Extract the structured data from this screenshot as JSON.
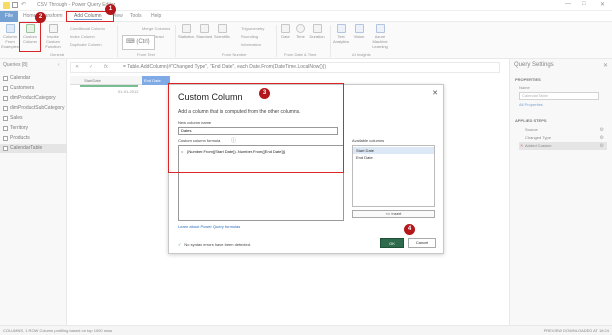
{
  "window": {
    "title": "CSV Through - Power Query Editor",
    "controls": [
      "—",
      "□",
      "✕"
    ]
  },
  "menu": {
    "file": "File",
    "tabs": [
      "Home",
      "Transform",
      "Add Column",
      "View",
      "Tools",
      "Help"
    ]
  },
  "ribbon": {
    "big_buttons": [
      "Column From Examples",
      "Custom Column",
      "Invoke Custom Function"
    ],
    "general_small": [
      "Conditional Column",
      "Index Column",
      "Duplicate Column"
    ],
    "format_small": [
      "Merge Columns",
      "ABC Extract",
      "Parse"
    ],
    "conditional_value": "(Ctrl)",
    "from_number_labels": [
      "Statistics",
      "Standard",
      "Scientific"
    ],
    "from_number_small": [
      "Trigonometry",
      "Rounding",
      "Information"
    ],
    "date_time_labels": [
      "Date",
      "Time",
      "Duration"
    ],
    "ai_labels": [
      "Text Analytics",
      "Vision",
      "Azure Machine Learning"
    ],
    "groups": [
      "General",
      "From Text",
      "From Number",
      "From Date & Time",
      "AI Insights"
    ]
  },
  "queries": {
    "header": "Queries [8]",
    "items": [
      "Calendar",
      "Customers",
      "dimProductCategory",
      "dimProductSubCategory",
      "Sales",
      "Territory",
      "Products",
      "CalendarTable"
    ],
    "selected": "CalendarTable"
  },
  "formula_bar": {
    "text": "= Table.AddColumn(#\"Changed Type\", \"End Date\", each Date.From(DateTime.LocalNow()))"
  },
  "grid": {
    "col1": "StartDate",
    "col2": "End Date",
    "cell": "01-01-2012"
  },
  "settings": {
    "title": "Query Settings",
    "properties": "PROPERTIES",
    "name_label": "Name",
    "name_value": "CalendarTable",
    "all_properties": "All Properties",
    "applied_steps": "APPLIED STEPS",
    "steps": [
      "Source",
      "Changed Type",
      "Added Custom"
    ],
    "selected_step": "Added Custom"
  },
  "statusbar": {
    "left": "COLUMNS, 1 ROW     Column profiling based on top 1000 rows",
    "right": "PREVIEW DOWNLOADED AT 18:24"
  },
  "dialog": {
    "title": "Custom Column",
    "description": "Add a column that is computed from the other columns.",
    "new_column_label": "New column name",
    "new_column_value": "Dates",
    "formula_label": "Custom column formula",
    "formula_eq": "=",
    "formula_text": "{Number.From([Start Date])..Number.From([End Date])}",
    "available_label": "Available columns",
    "available": [
      "Start Date",
      "End Date"
    ],
    "insert_label": "<< Insert",
    "learn_link": "Learn about Power Query formulas",
    "status": "No syntax errors have been detected.",
    "ok": "OK",
    "cancel": "Cancel",
    "close": "✕"
  },
  "annotations": [
    "1",
    "2",
    "3",
    "4"
  ]
}
